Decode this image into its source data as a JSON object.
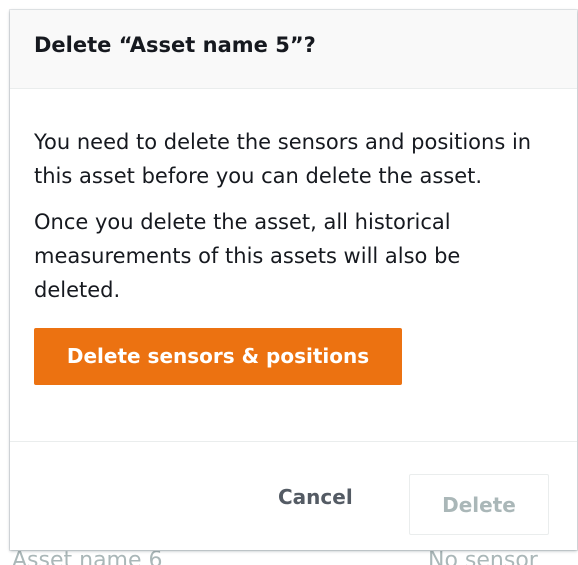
{
  "background_row": {
    "name": "Asset name 6",
    "status": "No sensor"
  },
  "modal": {
    "title": "Delete “Asset name 5”?",
    "paragraph_1": "You need to delete the sensors and positions in this asset before you can delete the asset.",
    "paragraph_2": "Once you delete the asset, all historical measurements of this assets will also be deleted.",
    "primary_action_label": "Delete sensors & positions",
    "cancel_label": "Cancel",
    "delete_label": "Delete",
    "delete_disabled": true
  },
  "colors": {
    "primary_button": "#ec7211",
    "disabled_text": "#aab7b8",
    "body_text": "#16191f"
  }
}
